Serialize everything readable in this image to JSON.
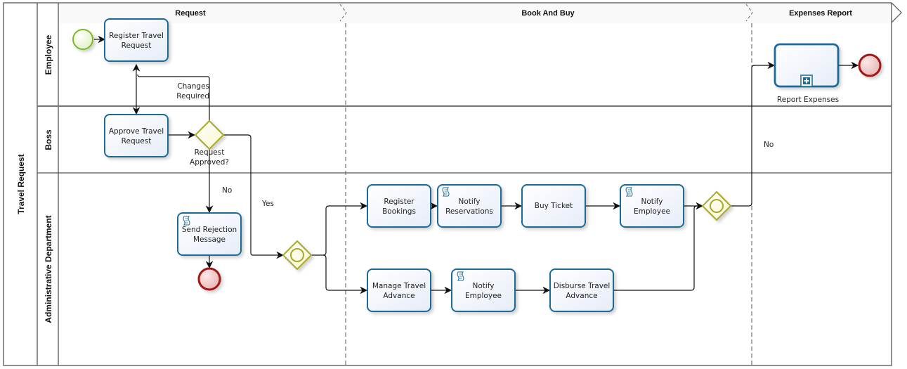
{
  "pool": {
    "title": "Travel Request"
  },
  "lanes": [
    {
      "id": "employee",
      "label": "Employee"
    },
    {
      "id": "boss",
      "label": "Boss"
    },
    {
      "id": "admin",
      "label": "Administrative Department"
    }
  ],
  "milestones": [
    {
      "id": "request",
      "label": "Request"
    },
    {
      "id": "book",
      "label": "Book And Buy"
    },
    {
      "id": "expenses",
      "label": "Expenses Report"
    }
  ],
  "tasks": {
    "register_travel_request": {
      "lines": [
        "Register Travel",
        "Request"
      ],
      "type": "task"
    },
    "approve_travel_request": {
      "lines": [
        "Approve Travel",
        "Request"
      ],
      "type": "task"
    },
    "send_rejection_message": {
      "lines": [
        "Send Rejection",
        "Message"
      ],
      "type": "script"
    },
    "register_bookings": {
      "lines": [
        "Register",
        "Bookings"
      ],
      "type": "task"
    },
    "notify_reservations": {
      "lines": [
        "Notify",
        "Reservations"
      ],
      "type": "script"
    },
    "buy_ticket": {
      "lines": [
        "Buy Ticket"
      ],
      "type": "task"
    },
    "notify_employee_1": {
      "lines": [
        "Notify",
        "Employee"
      ],
      "type": "script"
    },
    "manage_travel_advance": {
      "lines": [
        "Manage Travel",
        "Advance"
      ],
      "type": "task"
    },
    "notify_employee_2": {
      "lines": [
        "Notify",
        "Employee"
      ],
      "type": "script"
    },
    "disburse_travel_advance": {
      "lines": [
        "Disburse Travel",
        "Advance"
      ],
      "type": "task"
    },
    "report_expenses": {
      "label": "Report Expenses",
      "type": "subprocess"
    }
  },
  "gateways": {
    "request_approved": {
      "lines": [
        "Request",
        "Approved?"
      ],
      "type": "exclusive"
    },
    "split": {
      "type": "inclusive"
    },
    "join": {
      "type": "inclusive"
    }
  },
  "flow_labels": {
    "changes_required": [
      "Changes",
      "Required"
    ],
    "no_reject": "No",
    "yes": "Yes",
    "no_expenses": "No"
  },
  "colors": {
    "task_border": "#1a6b9a",
    "task_fill": "#eef2fb",
    "start_event": "#7cb82f",
    "end_event": "#a31515",
    "gateway": "#a8a829",
    "gateway_fill": "#fdfde0"
  }
}
